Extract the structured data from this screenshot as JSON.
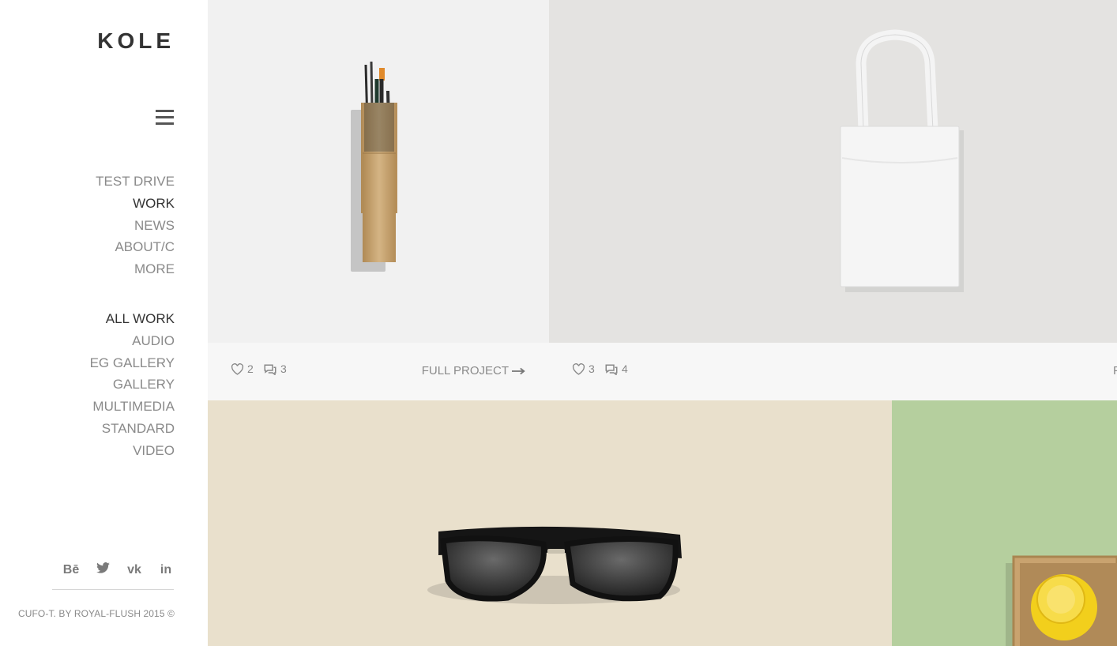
{
  "brand": {
    "logo": "KOLE"
  },
  "nav": {
    "main": [
      "TEST DRIVE",
      "WORK",
      "NEWS",
      "ABOUT/C",
      "MORE"
    ],
    "main_active": "WORK",
    "filters": [
      "ALL WORK",
      "AUDIO",
      "EG GALLERY",
      "GALLERY",
      "MULTIMEDIA",
      "STANDARD",
      "VIDEO"
    ],
    "filter_active": "ALL WORK"
  },
  "social": {
    "behance": "Bē",
    "twitter": "twitter-icon",
    "vk": "vk",
    "linkedin": "in"
  },
  "footer": {
    "copyright": "CUFO-T. BY ROYAL-FLUSH 2015 ©"
  },
  "projects": [
    {
      "likes": "2",
      "comments": "3",
      "link_label": "FULL PROJECT"
    },
    {
      "likes": "3",
      "comments": "4",
      "link_label": "F"
    }
  ],
  "colors": {
    "tile_brushes": "#f1f1f1",
    "tile_bag": "#e4e3e1",
    "tile_glasses": "#e9e0cc",
    "tile_cup": "#b5cf9e",
    "meta_bar": "#f7f7f7",
    "text_active": "#333333",
    "text_muted": "#8a8a8a"
  }
}
